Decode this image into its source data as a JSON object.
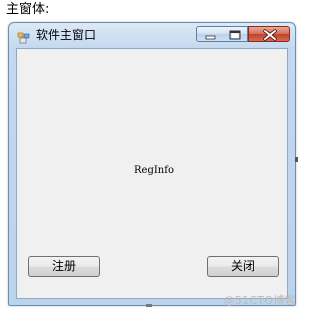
{
  "caption": "主窗体:",
  "window": {
    "title": "软件主窗口",
    "app_icon": "app-icon",
    "controls": {
      "minimize_icon": "minimize-icon",
      "maximize_icon": "maximize-icon",
      "close_icon": "close-icon"
    }
  },
  "content": {
    "label": "RegInfo"
  },
  "buttons": {
    "register": "注册",
    "close": "关闭"
  },
  "watermark": "@51CTO博客",
  "colors": {
    "titlebar": "#c4d8ee",
    "client": "#f0f0f0",
    "close_button": "#c1412a"
  }
}
